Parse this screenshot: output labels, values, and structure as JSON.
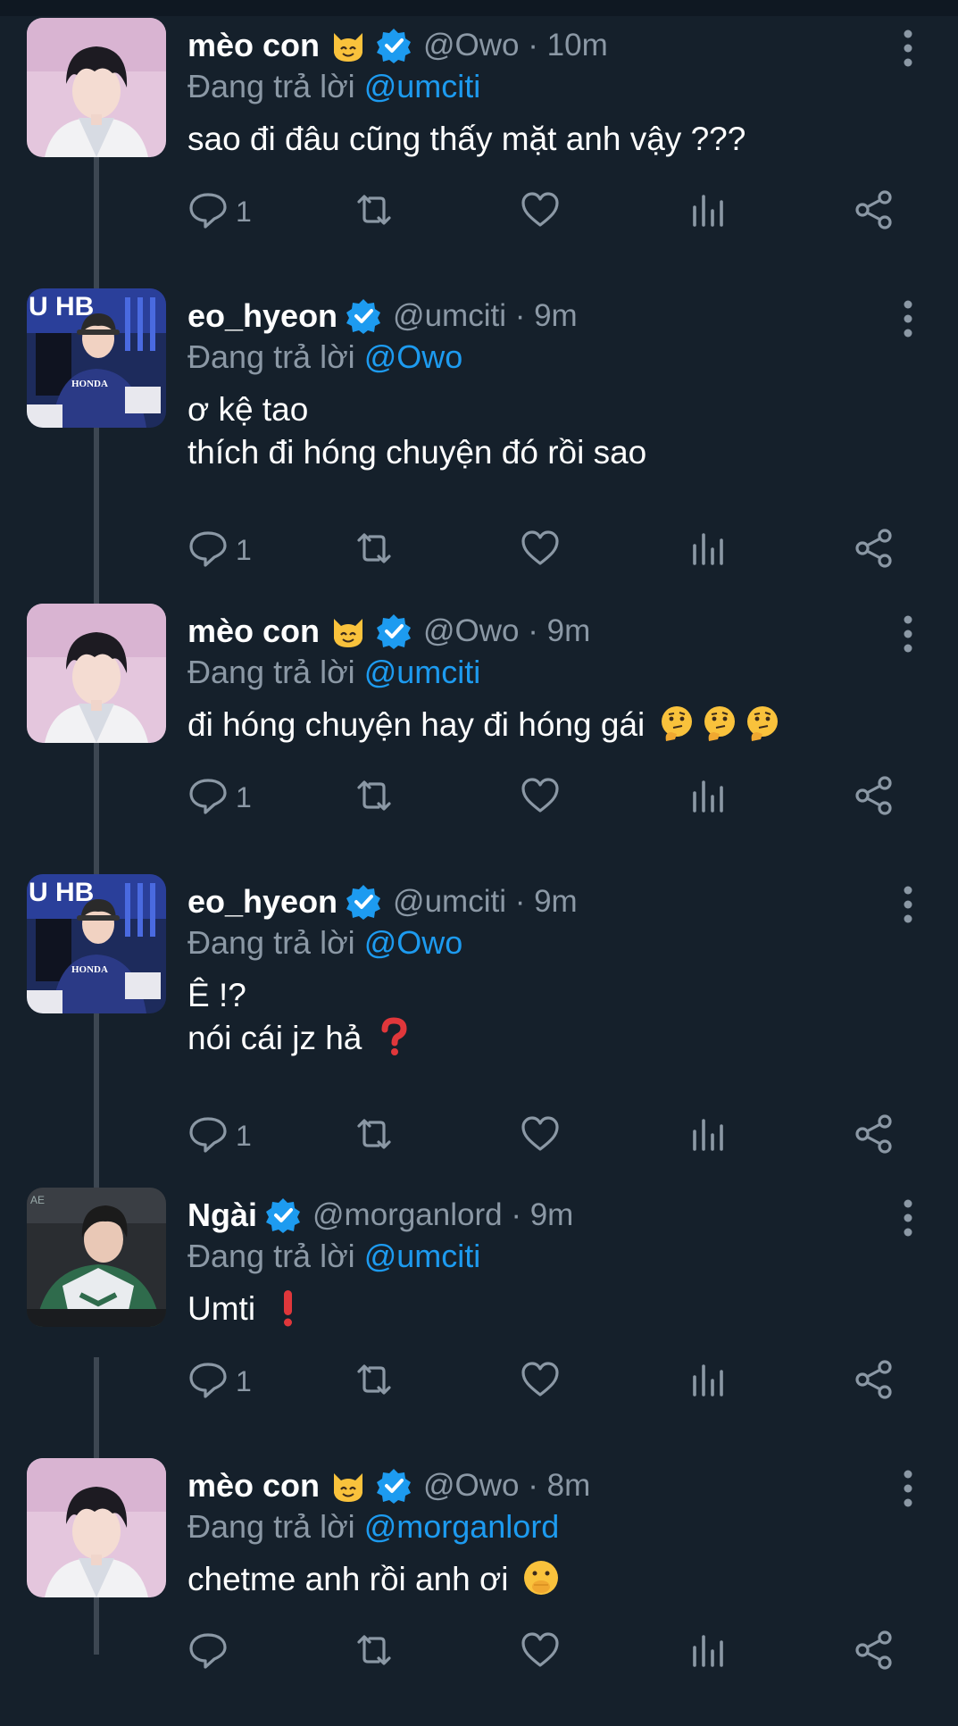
{
  "reply_prefix": "Đang trả lời ",
  "tweets": [
    {
      "name": "mèo con",
      "has_cat_emoji": true,
      "handle": "@Owo",
      "time": "10m",
      "reply_to": "@umciti",
      "text": "sao đi đâu cũng thấy mặt anh vậy ???",
      "reply_count": "1",
      "avatar": "pink-portrait"
    },
    {
      "name": "eo_hyeon",
      "has_cat_emoji": false,
      "handle": "@umciti",
      "time": "9m",
      "reply_to": "@Owo",
      "text": "ơ kệ tao\nthích đi hóng chuyện đó rồi sao",
      "reply_count": "1",
      "avatar": "gamer-honda"
    },
    {
      "name": "mèo con",
      "has_cat_emoji": true,
      "handle": "@Owo",
      "time": "9m",
      "reply_to": "@umciti",
      "text": "đi hóng chuyện hay đi hóng gái",
      "text_emoji": "🤔🤔🤔",
      "reply_count": "1",
      "avatar": "pink-portrait"
    },
    {
      "name": "eo_hyeon",
      "has_cat_emoji": false,
      "handle": "@umciti",
      "time": "9m",
      "reply_to": "@Owo",
      "text": "Ê !?\nnói cái jz hả",
      "text_emoji": "❓",
      "reply_count": "1",
      "avatar": "gamer-honda"
    },
    {
      "name": "Ngài",
      "has_cat_emoji": false,
      "handle": "@morganlord",
      "time": "9m",
      "reply_to": "@umciti",
      "text": "Umti",
      "text_emoji": "❗",
      "reply_count": "1",
      "avatar": "gamer-green"
    },
    {
      "name": "mèo con",
      "has_cat_emoji": true,
      "handle": "@Owo",
      "time": "8m",
      "reply_to": "@morganlord",
      "text": "chetme anh rồi anh ơi",
      "text_emoji": "🫢",
      "reply_count": "",
      "avatar": "pink-portrait"
    }
  ],
  "colors": {
    "background": "#15202b",
    "secondary_text": "#8b98a5",
    "link": "#1d9bf0",
    "thread_line": "#3d4752"
  }
}
